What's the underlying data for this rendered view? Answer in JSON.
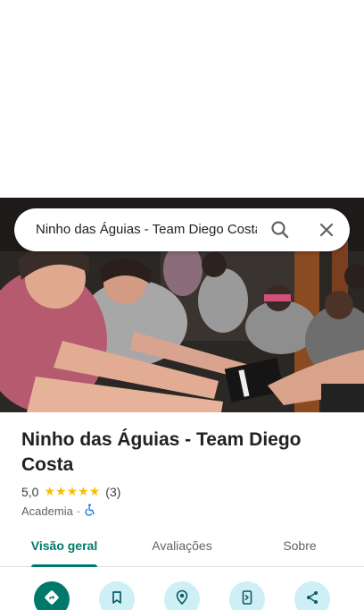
{
  "search": {
    "query": "Ninho das Águias - Team Diego Costa"
  },
  "place": {
    "title": "Ninho das Águias - Team Diego Costa",
    "rating": "5,0",
    "stars": 5,
    "star_glyphs": [
      "★",
      "★",
      "★",
      "★",
      "★"
    ],
    "review_count": "(3)",
    "category": "Academia",
    "separator": "·"
  },
  "tabs": [
    {
      "label": "Visão geral",
      "active": true
    },
    {
      "label": "Avaliações",
      "active": false
    },
    {
      "label": "Sobre",
      "active": false
    }
  ],
  "actions": [
    {
      "icon": "directions-icon"
    },
    {
      "icon": "bookmark-icon"
    },
    {
      "icon": "nearby-icon"
    },
    {
      "icon": "phone-icon"
    },
    {
      "icon": "share-icon"
    }
  ],
  "colors": {
    "accent": "#00796b",
    "action_bg": "#cdeff5",
    "star": "#fbbc04",
    "accessibility": "#1a73e8"
  }
}
